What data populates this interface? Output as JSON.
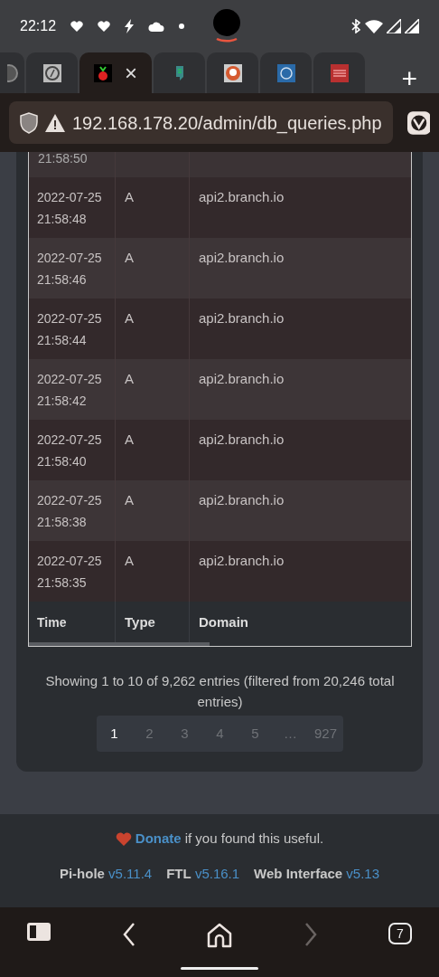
{
  "status_bar": {
    "time": "22:12"
  },
  "browser_tabs": [
    {
      "kind": "globe",
      "selected": false
    },
    {
      "kind": "at",
      "selected": false
    },
    {
      "kind": "berry",
      "selected": true,
      "close": "×"
    },
    {
      "kind": "note",
      "selected": false
    },
    {
      "kind": "duck",
      "selected": false
    },
    {
      "kind": "ring",
      "selected": false
    },
    {
      "kind": "news",
      "selected": false
    }
  ],
  "new_tab": "+",
  "address_bar": {
    "url": "192.168.178.20/admin/db_queries.php"
  },
  "table": {
    "partial_row": {
      "time": "21:58:50"
    },
    "rows": [
      {
        "date": "2022-07-25",
        "time": "21:58:48",
        "type": "A",
        "domain": "api2.branch.io"
      },
      {
        "date": "2022-07-25",
        "time": "21:58:46",
        "type": "A",
        "domain": "api2.branch.io"
      },
      {
        "date": "2022-07-25",
        "time": "21:58:44",
        "type": "A",
        "domain": "api2.branch.io"
      },
      {
        "date": "2022-07-25",
        "time": "21:58:42",
        "type": "A",
        "domain": "api2.branch.io"
      },
      {
        "date": "2022-07-25",
        "time": "21:58:40",
        "type": "A",
        "domain": "api2.branch.io"
      },
      {
        "date": "2022-07-25",
        "time": "21:58:38",
        "type": "A",
        "domain": "api2.branch.io"
      },
      {
        "date": "2022-07-25",
        "time": "21:58:35",
        "type": "A",
        "domain": "api2.branch.io"
      }
    ],
    "columns": [
      "Time",
      "Type",
      "Domain"
    ]
  },
  "info": "Showing 1 to 10 of 9,262 entries (filtered from 20,246 total entries)",
  "pagination": [
    {
      "label": "1",
      "selected": true
    },
    {
      "label": "2",
      "selected": false
    },
    {
      "label": "3",
      "selected": false
    },
    {
      "label": "4",
      "selected": false
    },
    {
      "label": "5",
      "selected": false
    },
    {
      "label": "…",
      "selected": false
    },
    {
      "label": "927",
      "selected": false
    }
  ],
  "footer": {
    "donate_link": "Donate",
    "donate_text": "if you found this useful.",
    "versions": [
      {
        "name": "Pi-hole",
        "version": "v5.11.4"
      },
      {
        "name": "FTL",
        "version": "v5.16.1"
      },
      {
        "name": "Web Interface",
        "version": "v5.13"
      }
    ]
  },
  "bottom_nav": {
    "tab_count": "7"
  }
}
